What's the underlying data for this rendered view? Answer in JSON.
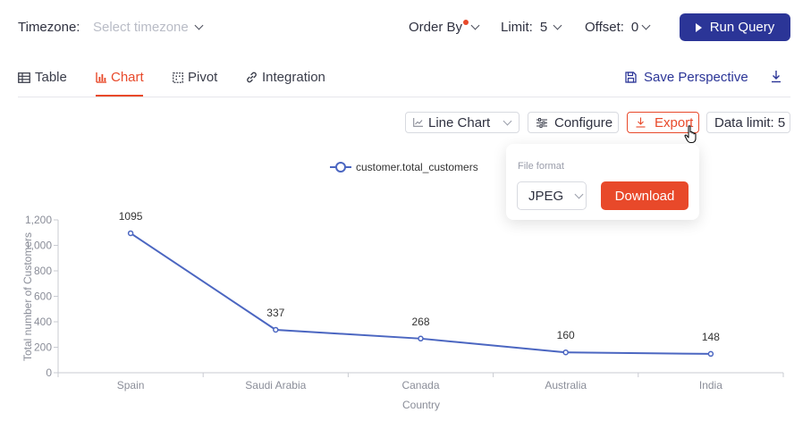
{
  "query_bar": {
    "timezone_label": "Timezone:",
    "timezone_placeholder": "Select timezone",
    "order_by_label": "Order By",
    "limit_label": "Limit:",
    "limit_value": "5",
    "offset_label": "Offset:",
    "offset_value": "0",
    "run_label": "Run Query"
  },
  "tabs": [
    {
      "label": "Table",
      "active": false
    },
    {
      "label": "Chart",
      "active": true
    },
    {
      "label": "Pivot",
      "active": false
    },
    {
      "label": "Integration",
      "active": false
    }
  ],
  "save_perspective_label": "Save Perspective",
  "toolbar": {
    "chart_type": "Line Chart",
    "configure_label": "Configure",
    "export_label": "Export",
    "data_limit_label": "Data limit: 5"
  },
  "export_popover": {
    "file_format_label": "File format",
    "format_value": "JPEG",
    "download_label": "Download"
  },
  "colors": {
    "accent": "#e8492a",
    "primary": "#2b3597",
    "series": "#4b66c1"
  },
  "chart_data": {
    "type": "line",
    "categories": [
      "Spain",
      "Saudi Arabia",
      "Canada",
      "Australia",
      "India"
    ],
    "series": [
      {
        "name": "customer.total_customers",
        "values": [
          1095,
          337,
          268,
          160,
          148
        ]
      }
    ],
    "data_labels": [
      "1095",
      "337",
      "268",
      "160",
      "148"
    ],
    "xlabel": "Country",
    "ylabel": "Total number of Customers",
    "ylim": [
      0,
      1200
    ],
    "yticks": [
      "0",
      "200",
      "400",
      "600",
      "800",
      "1,000",
      "1,200"
    ],
    "grid": false,
    "legend": "top-center"
  }
}
